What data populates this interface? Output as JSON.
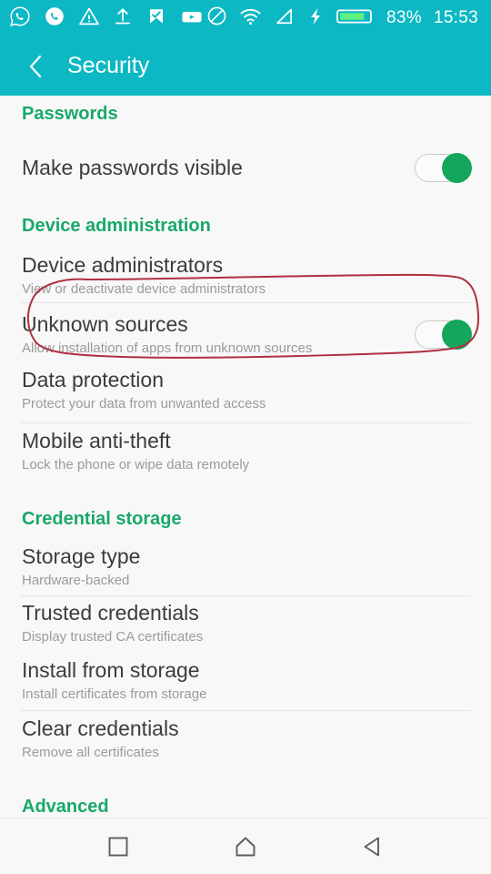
{
  "statusbar": {
    "left_icons": [
      "whatsapp-icon",
      "phone-call-icon",
      "warning-triangle-icon",
      "upload-icon",
      "checkmark-flag-icon",
      "youtube-icon"
    ],
    "right_icons": [
      "do-not-disturb-icon",
      "wifi-icon",
      "signal-icon",
      "charging-bolt-icon",
      "battery-icon"
    ],
    "battery_percent": "83%",
    "clock": "15:53",
    "bar_color": "#0cb8c4",
    "battery_fill_color": "#5ff07e"
  },
  "appbar": {
    "title": "Security",
    "back_icon": "back-chevron-icon",
    "color": "#0cb8c4"
  },
  "colors": {
    "section_header": "#1aa86a",
    "row_title": "#3c3c3c",
    "row_subtitle": "#9b9b9b",
    "toggle_on": "#13a65c",
    "annotation": "#b03040",
    "background": "#f7f8f7"
  },
  "sections": [
    {
      "header": "Passwords",
      "rows": [
        {
          "title": "Make passwords visible",
          "subtitle": "",
          "control": "toggle",
          "toggle_state": "on"
        }
      ]
    },
    {
      "header": "Device administration",
      "rows": [
        {
          "title": "Device administrators",
          "subtitle": "View or deactivate device administrators",
          "control": "none",
          "toggle_state": ""
        },
        {
          "title": "Unknown sources",
          "subtitle": "Allow installation of apps from unknown sources",
          "control": "toggle",
          "toggle_state": "on",
          "annotated": true
        },
        {
          "title": "Data protection",
          "subtitle": "Protect your data from unwanted access",
          "control": "none",
          "toggle_state": ""
        },
        {
          "title": "Mobile anti-theft",
          "subtitle": "Lock the phone or wipe data remotely",
          "control": "none",
          "toggle_state": ""
        }
      ]
    },
    {
      "header": "Credential storage",
      "rows": [
        {
          "title": "Storage type",
          "subtitle": "Hardware-backed",
          "control": "none",
          "toggle_state": ""
        },
        {
          "title": "Trusted credentials",
          "subtitle": "Display trusted CA certificates",
          "control": "none",
          "toggle_state": ""
        },
        {
          "title": "Install from storage",
          "subtitle": "Install certificates from storage",
          "control": "none",
          "toggle_state": ""
        },
        {
          "title": "Clear credentials",
          "subtitle": "Remove all certificates",
          "control": "none",
          "toggle_state": ""
        }
      ]
    },
    {
      "header": "Advanced",
      "rows": []
    }
  ],
  "navbar": {
    "recents_label": "recents-square-icon",
    "home_label": "home-icon",
    "back_label": "back-triangle-icon"
  }
}
